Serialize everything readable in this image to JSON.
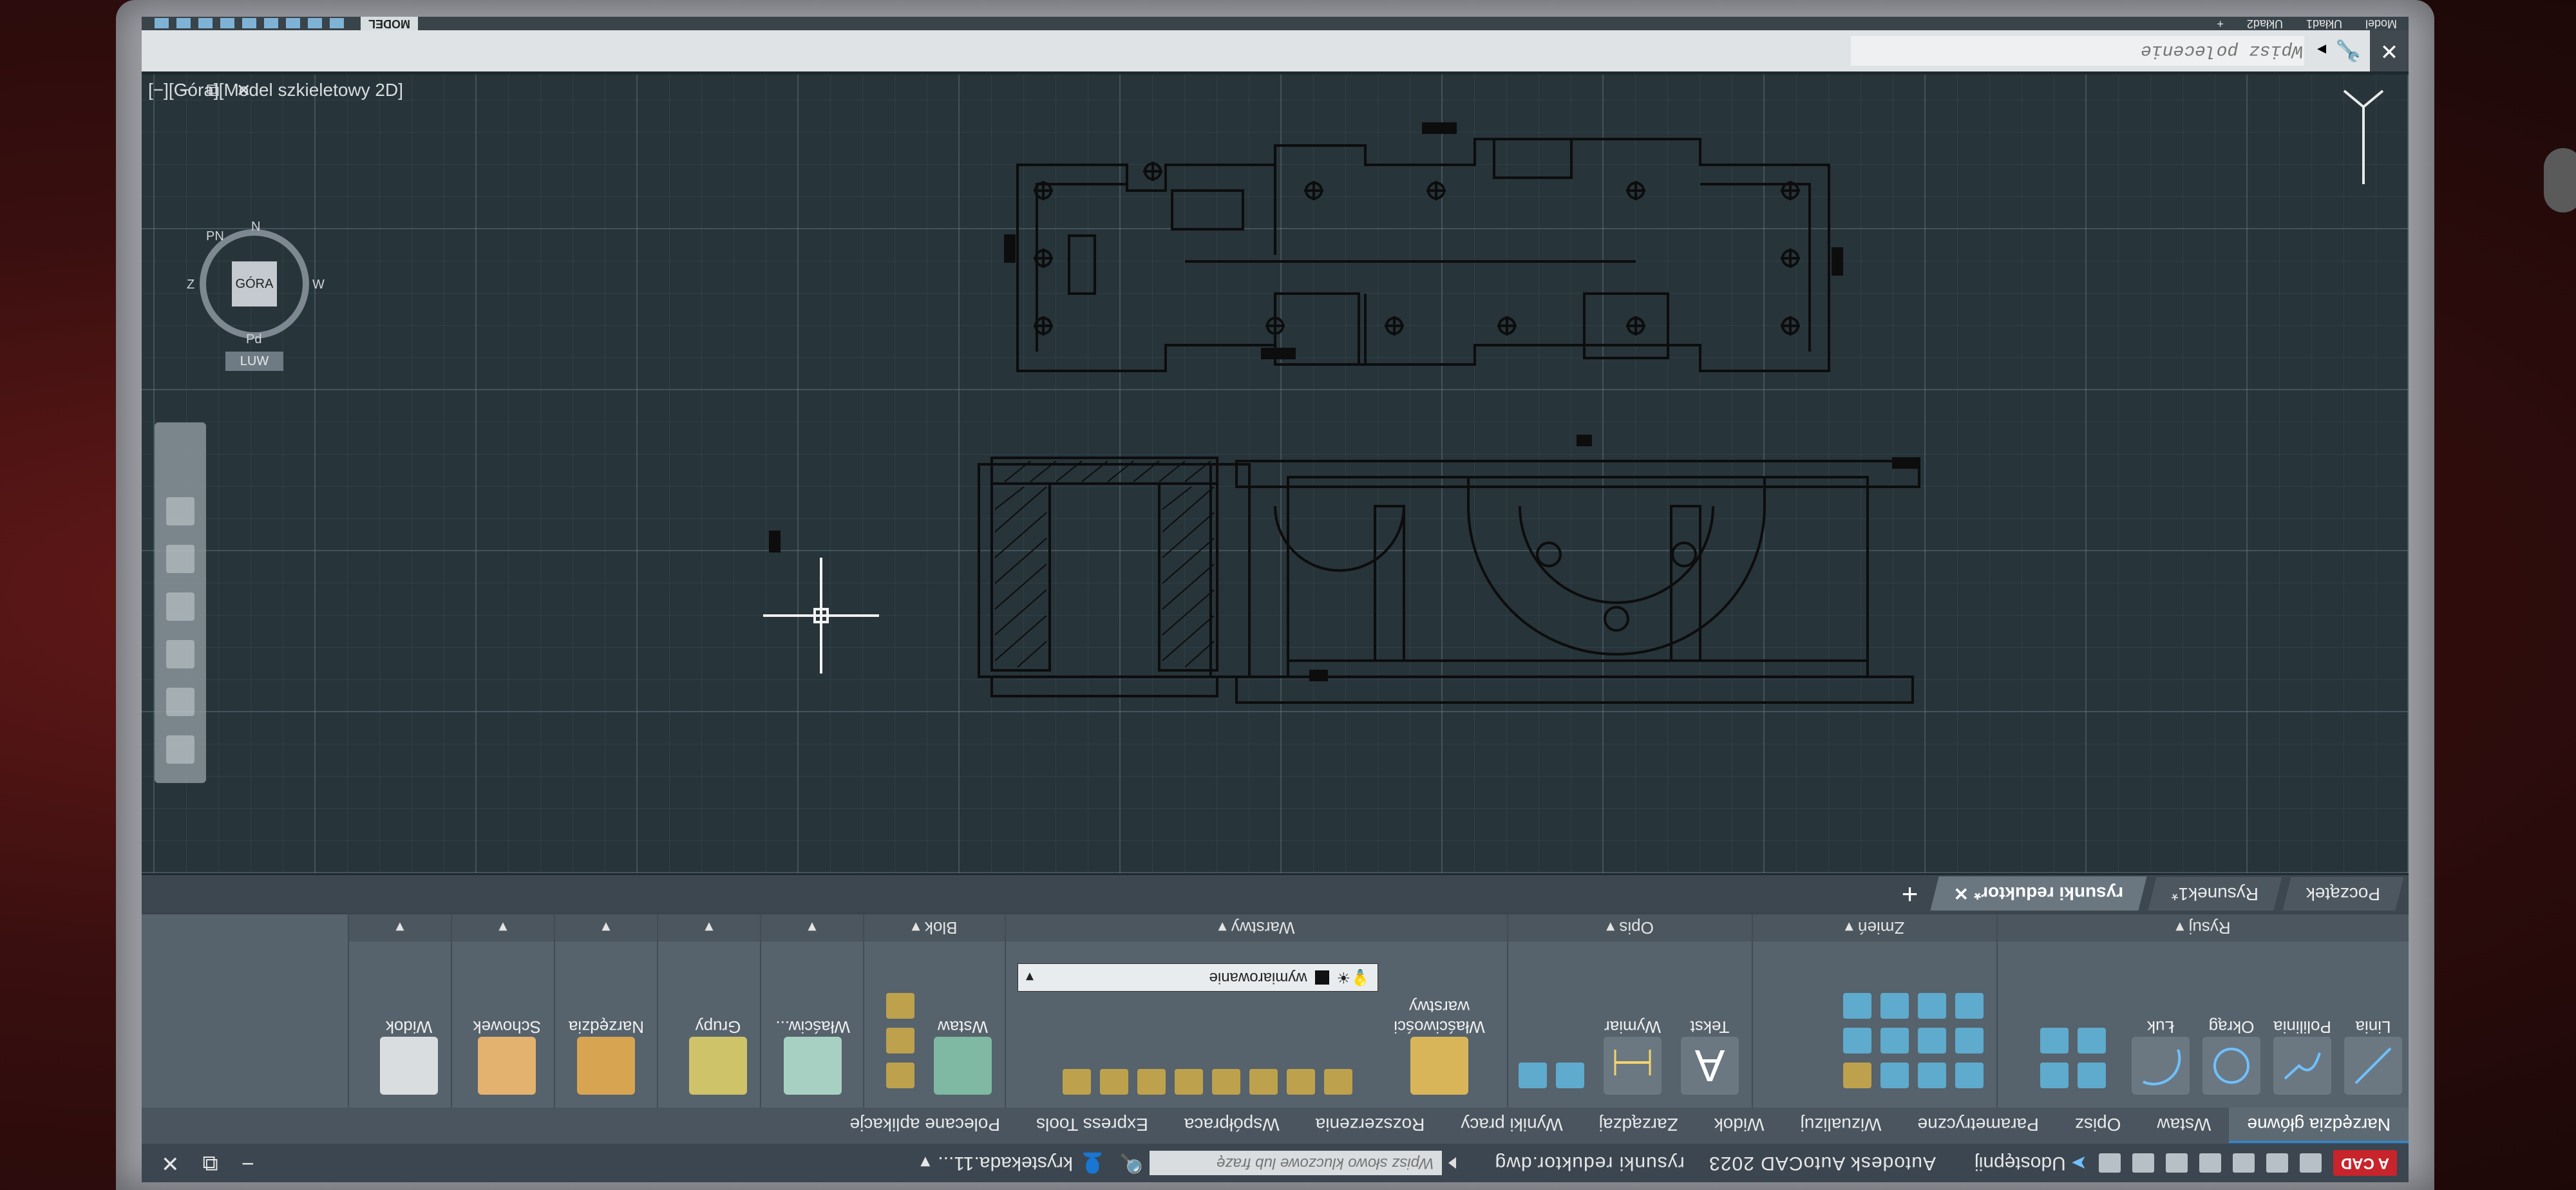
{
  "app": {
    "badge": "A CAD",
    "title": "Autodesk AutoCAD 2023",
    "file": "rysunki reduktor.dwg",
    "share_label": "Udostępnij",
    "search_placeholder": "Wpisz słowo kluczowe lub frazę",
    "user": "krystekada.11...",
    "window_controls": [
      "−",
      "⧉",
      "✕"
    ]
  },
  "ribbon_tabs": [
    {
      "label": "Narzędzia główne",
      "active": true
    },
    {
      "label": "Wstaw"
    },
    {
      "label": "Opisz"
    },
    {
      "label": "Parametryczne"
    },
    {
      "label": "Wizualizuj"
    },
    {
      "label": "Widok"
    },
    {
      "label": "Zarządzaj"
    },
    {
      "label": "Wyniki pracy"
    },
    {
      "label": "Rozszerzenia"
    },
    {
      "label": "Współpraca"
    },
    {
      "label": "Express Tools"
    },
    {
      "label": "Polecane aplikacje"
    }
  ],
  "panels": {
    "rysuj": {
      "label": "Rysuj ▾",
      "tools": [
        "Linia",
        "Polilinia",
        "Okrąg",
        "Łuk"
      ]
    },
    "zmien": {
      "label": "Zmień ▾"
    },
    "opis": {
      "label": "Opis ▾",
      "tools": [
        "Tekst",
        "Wymiar"
      ]
    },
    "warstwy": {
      "label": "Warstwy ▾",
      "tools": [
        "Właściwości warstwy"
      ],
      "current_layer": "wymiarowanie"
    },
    "blok": {
      "label": "Blok ▾",
      "tools": [
        "Wstaw"
      ]
    },
    "wlasciwosci": {
      "label": "▾",
      "tool": "Właściw..."
    },
    "grupy": {
      "label": "▾",
      "tool": "Grupy"
    },
    "narzedzia": {
      "label": "▾",
      "tool": "Narzędzia"
    },
    "schowek": {
      "label": "▾",
      "tool": "Schowek"
    },
    "widok": {
      "label": "▾",
      "tool": "Widok"
    }
  },
  "file_tabs": [
    {
      "label": "Początek"
    },
    {
      "label": "Rysunek1*"
    },
    {
      "label": "rysunki reduktor*",
      "active": true,
      "close": "✕"
    }
  ],
  "file_tabs_add": "+",
  "viewport": {
    "label": "[−][Góra][Model szkieletowy 2D]",
    "controls": [
      "−",
      "⧉",
      "✕"
    ],
    "viewcube": {
      "face": "GÓRA",
      "n": "N",
      "s": "Pd",
      "e": "W",
      "w": "Z",
      "ne": "PN",
      "wcs": "LUW"
    }
  },
  "command_line": {
    "placeholder": "Wpisz polecenie",
    "close": "✕"
  },
  "status_bar": {
    "model": "MODEL",
    "layout_tabs": [
      "Model",
      "Układ1",
      "Układ2"
    ],
    "add": "+"
  },
  "colors": {
    "ribbon": "#56626c",
    "viewport_bg": "#27343a",
    "linework": "#111111",
    "accent": "#2b8ad8",
    "badge": "#c8242b"
  }
}
